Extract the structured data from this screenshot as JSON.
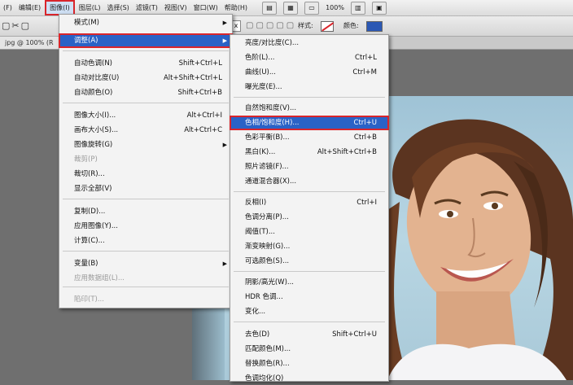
{
  "menubar": {
    "items": [
      "(F)",
      "编辑(E)",
      "图像(I)",
      "图层(L)",
      "选择(S)",
      "滤镜(T)",
      "视图(V)",
      "窗口(W)",
      "帮助(H)"
    ],
    "active_index": 2,
    "zoom": "100%"
  },
  "options": {
    "x_label": "x",
    "style_label": "样式:",
    "color_label": "颜色:",
    "style_swatch_color": "#ffffff",
    "color_swatch_color": "#2b58b4"
  },
  "doc_tab": {
    "label": "jpg @ 100% (R"
  },
  "image_menu": {
    "items": [
      {
        "label": "模式(M)",
        "shortcut": "",
        "submenu": true,
        "disabled": false
      },
      {
        "label": "调整(A)",
        "shortcut": "",
        "submenu": true,
        "disabled": false,
        "highlight": true
      },
      {
        "label": "自动色调(N)",
        "shortcut": "Shift+Ctrl+L",
        "disabled": false
      },
      {
        "label": "自动对比度(U)",
        "shortcut": "Alt+Shift+Ctrl+L",
        "disabled": false
      },
      {
        "label": "自动颜色(O)",
        "shortcut": "Shift+Ctrl+B",
        "disabled": false
      },
      {
        "label": "图像大小(I)...",
        "shortcut": "Alt+Ctrl+I",
        "disabled": false
      },
      {
        "label": "画布大小(S)...",
        "shortcut": "Alt+Ctrl+C",
        "disabled": false
      },
      {
        "label": "图像旋转(G)",
        "shortcut": "",
        "submenu": true,
        "disabled": false
      },
      {
        "label": "裁剪(P)",
        "shortcut": "",
        "disabled": true
      },
      {
        "label": "裁切(R)...",
        "shortcut": "",
        "disabled": false
      },
      {
        "label": "显示全部(V)",
        "shortcut": "",
        "disabled": false
      },
      {
        "label": "复制(D)...",
        "shortcut": "",
        "disabled": false
      },
      {
        "label": "应用图像(Y)...",
        "shortcut": "",
        "disabled": false
      },
      {
        "label": "计算(C)...",
        "shortcut": "",
        "disabled": false
      },
      {
        "label": "变量(B)",
        "shortcut": "",
        "submenu": true,
        "disabled": false
      },
      {
        "label": "应用数据组(L)...",
        "shortcut": "",
        "disabled": true
      },
      {
        "label": "陷印(T)...",
        "shortcut": "",
        "disabled": true
      }
    ]
  },
  "adjust_menu": {
    "items": [
      {
        "label": "亮度/对比度(C)...",
        "shortcut": ""
      },
      {
        "label": "色阶(L)...",
        "shortcut": "Ctrl+L"
      },
      {
        "label": "曲线(U)...",
        "shortcut": "Ctrl+M"
      },
      {
        "label": "曝光度(E)...",
        "shortcut": ""
      },
      {
        "label": "自然饱和度(V)...",
        "shortcut": ""
      },
      {
        "label": "色相/饱和度(H)...",
        "shortcut": "Ctrl+U",
        "highlight": true
      },
      {
        "label": "色彩平衡(B)...",
        "shortcut": "Ctrl+B"
      },
      {
        "label": "黑白(K)...",
        "shortcut": "Alt+Shift+Ctrl+B"
      },
      {
        "label": "照片滤镜(F)...",
        "shortcut": ""
      },
      {
        "label": "通道混合器(X)...",
        "shortcut": ""
      },
      {
        "label": "反相(I)",
        "shortcut": "Ctrl+I"
      },
      {
        "label": "色调分离(P)...",
        "shortcut": ""
      },
      {
        "label": "阈值(T)...",
        "shortcut": ""
      },
      {
        "label": "渐变映射(G)...",
        "shortcut": ""
      },
      {
        "label": "可选颜色(S)...",
        "shortcut": ""
      },
      {
        "label": "阴影/高光(W)...",
        "shortcut": ""
      },
      {
        "label": "HDR 色调...",
        "shortcut": ""
      },
      {
        "label": "变化...",
        "shortcut": ""
      },
      {
        "label": "去色(D)",
        "shortcut": "Shift+Ctrl+U"
      },
      {
        "label": "匹配颜色(M)...",
        "shortcut": ""
      },
      {
        "label": "替换颜色(R)...",
        "shortcut": ""
      },
      {
        "label": "色调均化(Q)",
        "shortcut": ""
      }
    ]
  }
}
